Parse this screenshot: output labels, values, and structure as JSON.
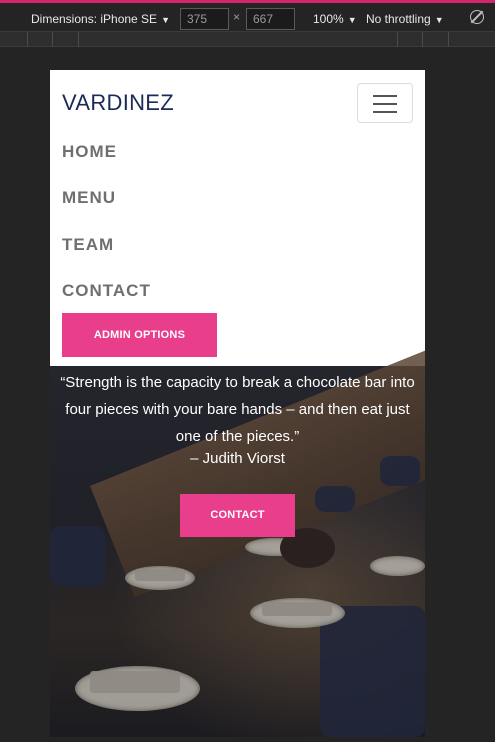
{
  "devtools": {
    "device_label": "Dimensions: iPhone SE",
    "width": "375",
    "times": "×",
    "height": "667",
    "zoom": "100%",
    "throttling": "No throttling",
    "caret": "▼",
    "accent_color": "#d4246e"
  },
  "navbar": {
    "brand": "VARDINEZ",
    "brand_color": "#1c2a57",
    "toggler_icon": "hamburger-icon",
    "links": [
      "HOME",
      "MENU",
      "TEAM",
      "CONTACT"
    ],
    "admin_button": "ADMIN OPTIONS",
    "button_color": "#e83e8c"
  },
  "hero": {
    "quote": "“Strength is the capacity to break a chocolate bar into four pieces with your bare hands – and then eat just one of the pieces.”",
    "author": "– Judith Viorst",
    "contact_button": "CONTACT"
  }
}
